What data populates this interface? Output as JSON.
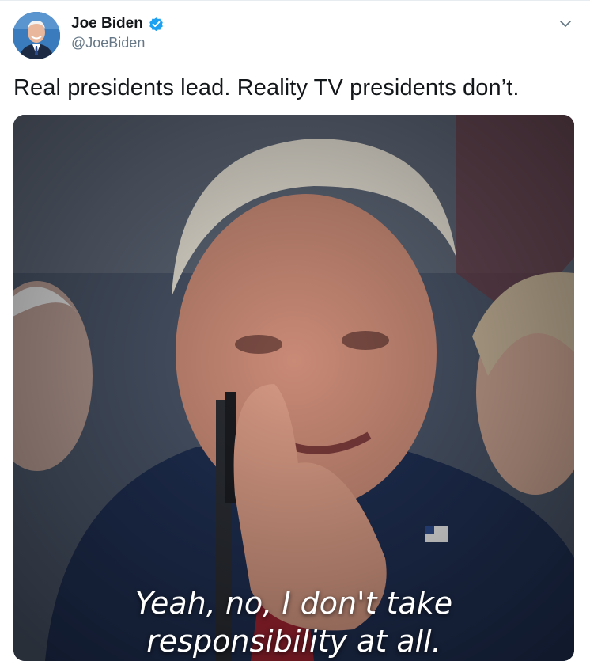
{
  "author": {
    "display_name": "Joe Biden",
    "handle": "@JoeBiden",
    "verified": true,
    "avatar_icon": "avatar-photo"
  },
  "tweet": {
    "text": "Real presidents lead. Reality TV presidents don’t."
  },
  "media": {
    "type": "video",
    "subtitle_line1": "Yeah, no, I don't take",
    "subtitle_line2": "responsibility at all."
  },
  "colors": {
    "verified_blue": "#1da1f2",
    "text_primary": "#14171a",
    "text_secondary": "#657786"
  }
}
